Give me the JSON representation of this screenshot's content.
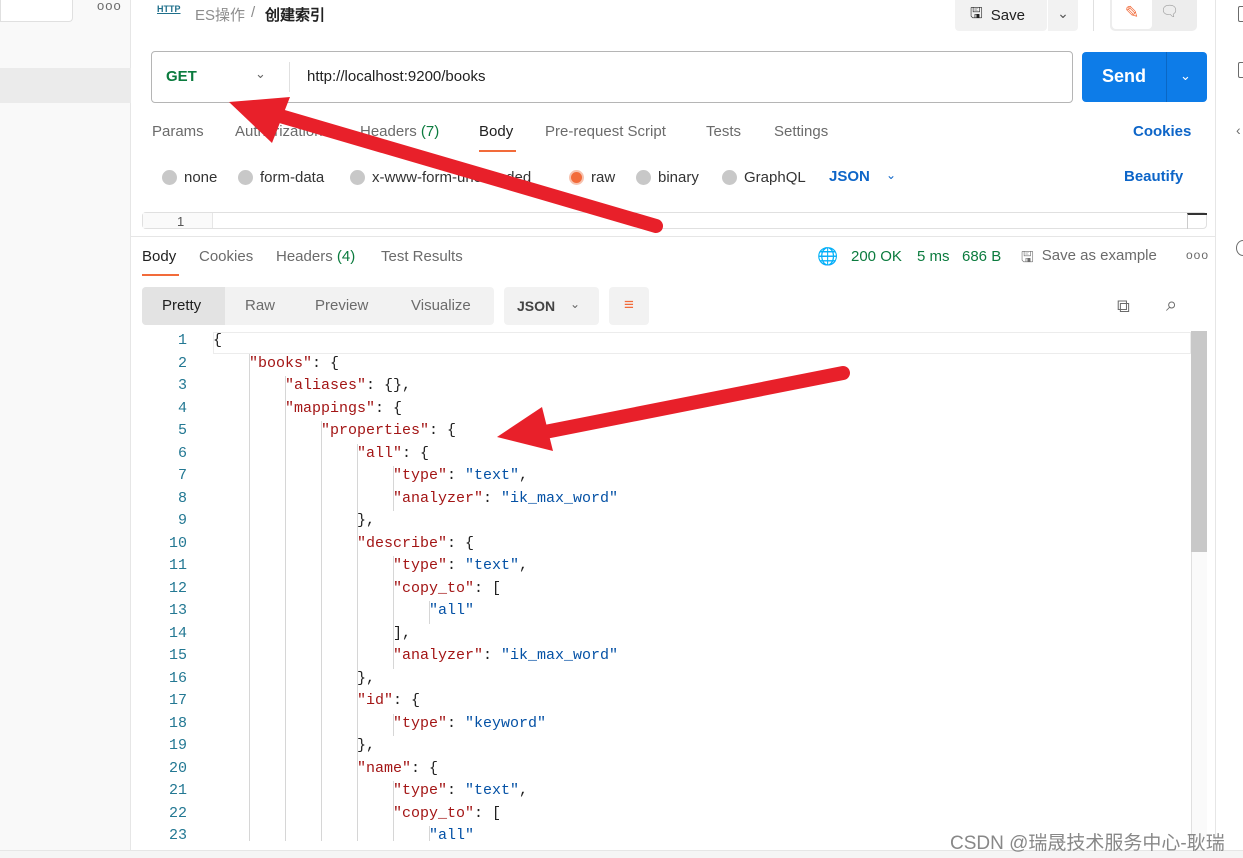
{
  "breadcrumb": {
    "icon": "http-icon",
    "icon_text": "HTTP",
    "collection": "ES操作",
    "separator": "/",
    "request": "创建索引"
  },
  "toolbar": {
    "save_label": "Save"
  },
  "request": {
    "method": "GET",
    "url": "http://localhost:9200/books",
    "send_label": "Send"
  },
  "request_tabs": [
    {
      "label": "Params"
    },
    {
      "label": "Authorization"
    },
    {
      "label": "Headers",
      "count": "(7)"
    },
    {
      "label": "Body",
      "active": true
    },
    {
      "label": "Pre-request Script"
    },
    {
      "label": "Tests"
    },
    {
      "label": "Settings"
    }
  ],
  "cookies_label": "Cookies",
  "body_types": [
    {
      "label": "none"
    },
    {
      "label": "form-data"
    },
    {
      "label": "x-www-form-urlencoded"
    },
    {
      "label": "raw",
      "selected": true
    },
    {
      "label": "binary"
    },
    {
      "label": "GraphQL"
    }
  ],
  "raw_type": "JSON",
  "beautify_label": "Beautify",
  "request_editor": {
    "line": "1"
  },
  "response_tabs": [
    {
      "label": "Body",
      "active": true
    },
    {
      "label": "Cookies"
    },
    {
      "label": "Headers",
      "count": "(4)"
    },
    {
      "label": "Test Results"
    }
  ],
  "response_status": {
    "status": "200 OK",
    "time": "5 ms",
    "size": "686 B",
    "save_example": "Save as example"
  },
  "view_modes": [
    {
      "label": "Pretty",
      "active": true
    },
    {
      "label": "Raw"
    },
    {
      "label": "Preview"
    },
    {
      "label": "Visualize"
    }
  ],
  "response_format": "JSON",
  "colors": {
    "accent": "#f26b3a",
    "send": "#0d7ce8",
    "link": "#0d65c8",
    "status_ok": "#0b7b3e",
    "json_key": "#a31515",
    "json_string": "#0451a5",
    "annotation_arrow": "#e8202a"
  },
  "code_lines": [
    {
      "n": "1",
      "indent": 0,
      "text": "{"
    },
    {
      "n": "2",
      "indent": 1,
      "text": "\"books\": {"
    },
    {
      "n": "3",
      "indent": 2,
      "text": "\"aliases\": {},"
    },
    {
      "n": "4",
      "indent": 2,
      "text": "\"mappings\": {"
    },
    {
      "n": "5",
      "indent": 3,
      "text": "\"properties\": {"
    },
    {
      "n": "6",
      "indent": 4,
      "text": "\"all\": {"
    },
    {
      "n": "7",
      "indent": 5,
      "text": "\"type\": \"text\","
    },
    {
      "n": "8",
      "indent": 5,
      "text": "\"analyzer\": \"ik_max_word\""
    },
    {
      "n": "9",
      "indent": 4,
      "text": "},"
    },
    {
      "n": "10",
      "indent": 4,
      "text": "\"describe\": {"
    },
    {
      "n": "11",
      "indent": 5,
      "text": "\"type\": \"text\","
    },
    {
      "n": "12",
      "indent": 5,
      "text": "\"copy_to\": ["
    },
    {
      "n": "13",
      "indent": 6,
      "text": "\"all\""
    },
    {
      "n": "14",
      "indent": 5,
      "text": "],"
    },
    {
      "n": "15",
      "indent": 5,
      "text": "\"analyzer\": \"ik_max_word\""
    },
    {
      "n": "16",
      "indent": 4,
      "text": "},"
    },
    {
      "n": "17",
      "indent": 4,
      "text": "\"id\": {"
    },
    {
      "n": "18",
      "indent": 5,
      "text": "\"type\": \"keyword\""
    },
    {
      "n": "19",
      "indent": 4,
      "text": "},"
    },
    {
      "n": "20",
      "indent": 4,
      "text": "\"name\": {"
    },
    {
      "n": "21",
      "indent": 5,
      "text": "\"type\": \"text\","
    },
    {
      "n": "22",
      "indent": 5,
      "text": "\"copy_to\": ["
    },
    {
      "n": "23",
      "indent": 6,
      "text": "\"all\""
    }
  ],
  "watermark": "CSDN @瑞晟技术服务中心-耿瑞"
}
